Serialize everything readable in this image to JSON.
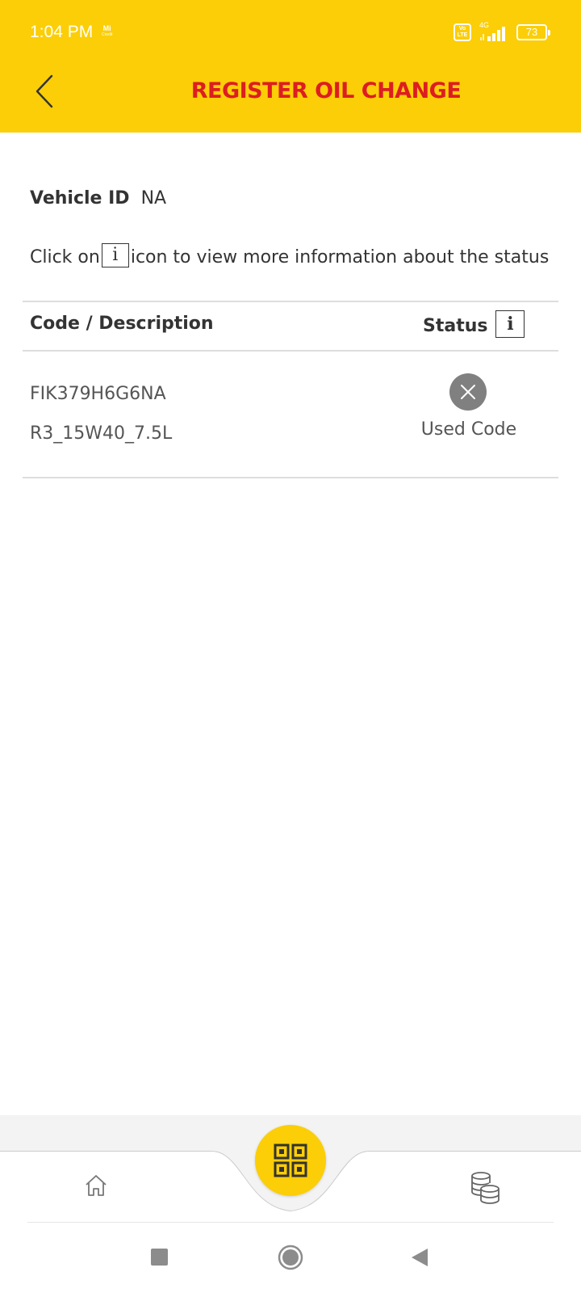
{
  "status_bar": {
    "time": "1:04 PM",
    "carrier_line1": "Mi",
    "carrier_line2": "Credit",
    "volte_top": "Vo",
    "volte_bottom": "LTE",
    "network": "4G",
    "battery": "73"
  },
  "header": {
    "title": "REGISTER OIL CHANGE",
    "back_icon": "chevron-left-icon"
  },
  "vehicle": {
    "label": "Vehicle ID",
    "value": "NA"
  },
  "hint": {
    "prefix": "Click on",
    "info_glyph": "i",
    "suffix": "icon to view more information about the status"
  },
  "table": {
    "headers": {
      "code": "Code / Description",
      "status": "Status",
      "info_glyph": "i"
    },
    "rows": [
      {
        "code": "FIK379H6G6NA",
        "description": "R3_15W40_7.5L",
        "status": "Used Code",
        "status_icon": "close-circle-icon"
      }
    ]
  },
  "bottom_nav": {
    "home_icon": "home-icon",
    "scan_icon": "qr-code-icon",
    "rewards_icon": "coins-icon"
  },
  "system_nav": {
    "recents_icon": "square-icon",
    "home_icon": "circle-icon",
    "back_icon": "triangle-back-icon"
  },
  "colors": {
    "brand_yellow": "#FBCE07",
    "brand_red": "#DD1D21",
    "status_grey": "#808080"
  }
}
